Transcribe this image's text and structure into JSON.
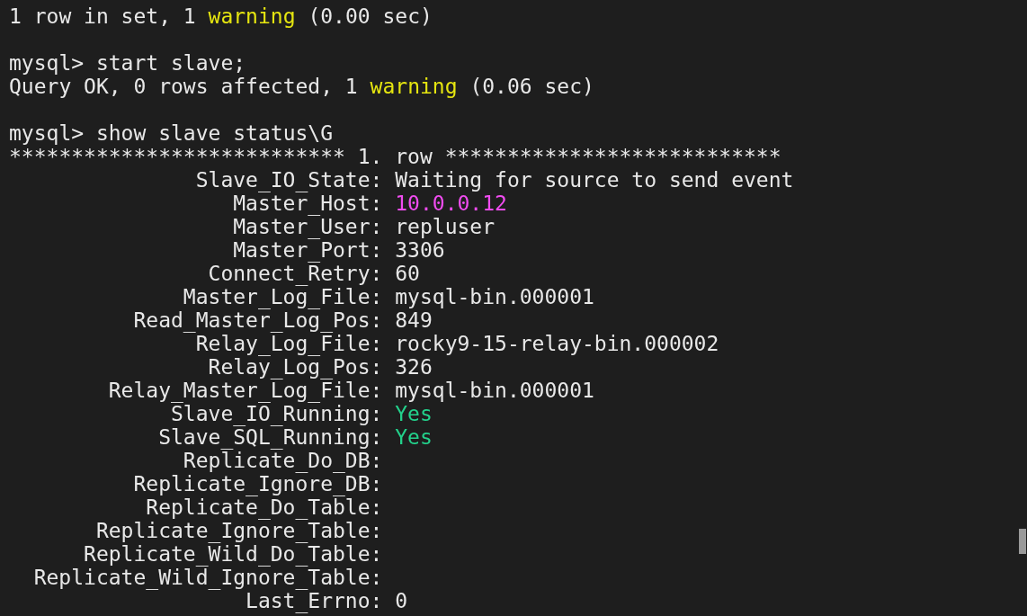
{
  "terminal": {
    "lines": [
      {
        "kind": "output",
        "segments": [
          {
            "text": "1 row in set, 1"
          },
          {
            "text": "warning",
            "color": "#e5e510"
          },
          {
            "text": "(0.00 sec)"
          }
        ]
      },
      {
        "kind": "blank"
      },
      {
        "kind": "output",
        "segments": [
          {
            "text": "mysql> start slave;"
          }
        ]
      },
      {
        "kind": "output",
        "segments": [
          {
            "text": "Query OK, 0 rows affected, 1"
          },
          {
            "text": "warning",
            "color": "#e5e510"
          },
          {
            "text": "(0.06 sec)"
          }
        ]
      },
      {
        "kind": "blank"
      },
      {
        "kind": "output",
        "segments": [
          {
            "text": "mysql> show slave status\\G"
          }
        ]
      },
      {
        "kind": "output",
        "segments": [
          {
            "text": "*************************** 1. row ***************************"
          }
        ]
      },
      {
        "kind": "field",
        "key": "Slave_IO_State:",
        "value": "Waiting for source to send event"
      },
      {
        "kind": "field",
        "key": "Master_Host:",
        "value": "10.0.0.12",
        "color": "#f14cf1"
      },
      {
        "kind": "field",
        "key": "Master_User:",
        "value": "repluser"
      },
      {
        "kind": "field",
        "key": "Master_Port:",
        "value": "3306"
      },
      {
        "kind": "field",
        "key": "Connect_Retry:",
        "value": "60"
      },
      {
        "kind": "field",
        "key": "Master_Log_File:",
        "value": "mysql-bin.000001"
      },
      {
        "kind": "field",
        "key": "Read_Master_Log_Pos:",
        "value": "849"
      },
      {
        "kind": "field",
        "key": "Relay_Log_File:",
        "value": "rocky9-15-relay-bin.000002"
      },
      {
        "kind": "field",
        "key": "Relay_Log_Pos:",
        "value": "326"
      },
      {
        "kind": "field",
        "key": "Relay_Master_Log_File:",
        "value": "mysql-bin.000001"
      },
      {
        "kind": "field",
        "key": "Slave_IO_Running:",
        "value": "Yes",
        "color": "#23d18b"
      },
      {
        "kind": "field",
        "key": "Slave_SQL_Running:",
        "value": "Yes",
        "color": "#23d18b"
      },
      {
        "kind": "field",
        "key": "Replicate_Do_DB:"
      },
      {
        "kind": "field",
        "key": "Replicate_Ignore_DB:"
      },
      {
        "kind": "field",
        "key": "Replicate_Do_Table:"
      },
      {
        "kind": "field",
        "key": "Replicate_Ignore_Table:"
      },
      {
        "kind": "field",
        "key": "Replicate_Wild_Do_Table:"
      },
      {
        "kind": "field",
        "key": "Replicate_Wild_Ignore_Table:"
      },
      {
        "kind": "field",
        "key": "Last_Errno:",
        "value": "0"
      }
    ]
  }
}
